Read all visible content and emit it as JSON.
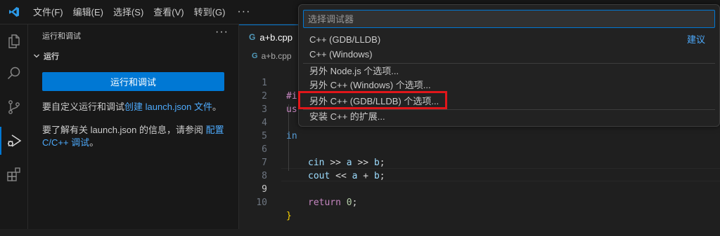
{
  "titlebar": {
    "menu": [
      "文件(F)",
      "编辑(E)",
      "选择(S)",
      "查看(V)",
      "转到(G)"
    ],
    "more": "···"
  },
  "activitybar": {
    "icons": [
      "explorer-icon",
      "search-icon",
      "source-control-icon",
      "run-debug-icon",
      "extensions-icon"
    ],
    "accent": "#0078d4"
  },
  "sidebar": {
    "title": "运行和调试",
    "more": "···",
    "section": "运行",
    "run_button": "运行和调试",
    "hint1_text": "要自定义运行和调试",
    "hint1_link": "创建 launch.json 文件",
    "hint1_end": "。",
    "hint2_text": "要了解有关 launch.json 的信息，请参阅",
    "hint2_link_a": "配置",
    "hint2_link_b": "C/C++ 调试",
    "hint2_end": "。"
  },
  "editor": {
    "tab_label": "a+b.cpp",
    "breadcrumb": "a+b.cpp",
    "line_numbers": [
      "1",
      "2",
      "3",
      "4",
      "5",
      "6",
      "7",
      "8",
      "9",
      "10"
    ],
    "code_fragments": {
      "l1": "#i",
      "l2": "us",
      "l4": "in",
      "l6_cin": "cin",
      "l6_op1": ">>",
      "l6_a": "a",
      "l6_op2": ">>",
      "l6_b": "b",
      "l6_semi": ";",
      "l7_cout": "cout",
      "l7_op1": "<<",
      "l7_a": "a",
      "l7_plus": "+",
      "l7_b": "b",
      "l7_semi": ";",
      "l9_ret": "return",
      "l9_zero": "0",
      "l9_semi": ";",
      "l10": "}"
    }
  },
  "quickpick": {
    "placeholder": "选择调试器",
    "items": [
      "C++ (GDB/LLDB)",
      "C++ (Windows)",
      "另外 Node.js 个选项...",
      "另外 C++ (Windows) 个选项...",
      "另外 C++ (GDB/LLDB) 个选项...",
      "安装 C++ 的扩展..."
    ],
    "tag": "建议",
    "highlight_color": "#e0161a"
  }
}
